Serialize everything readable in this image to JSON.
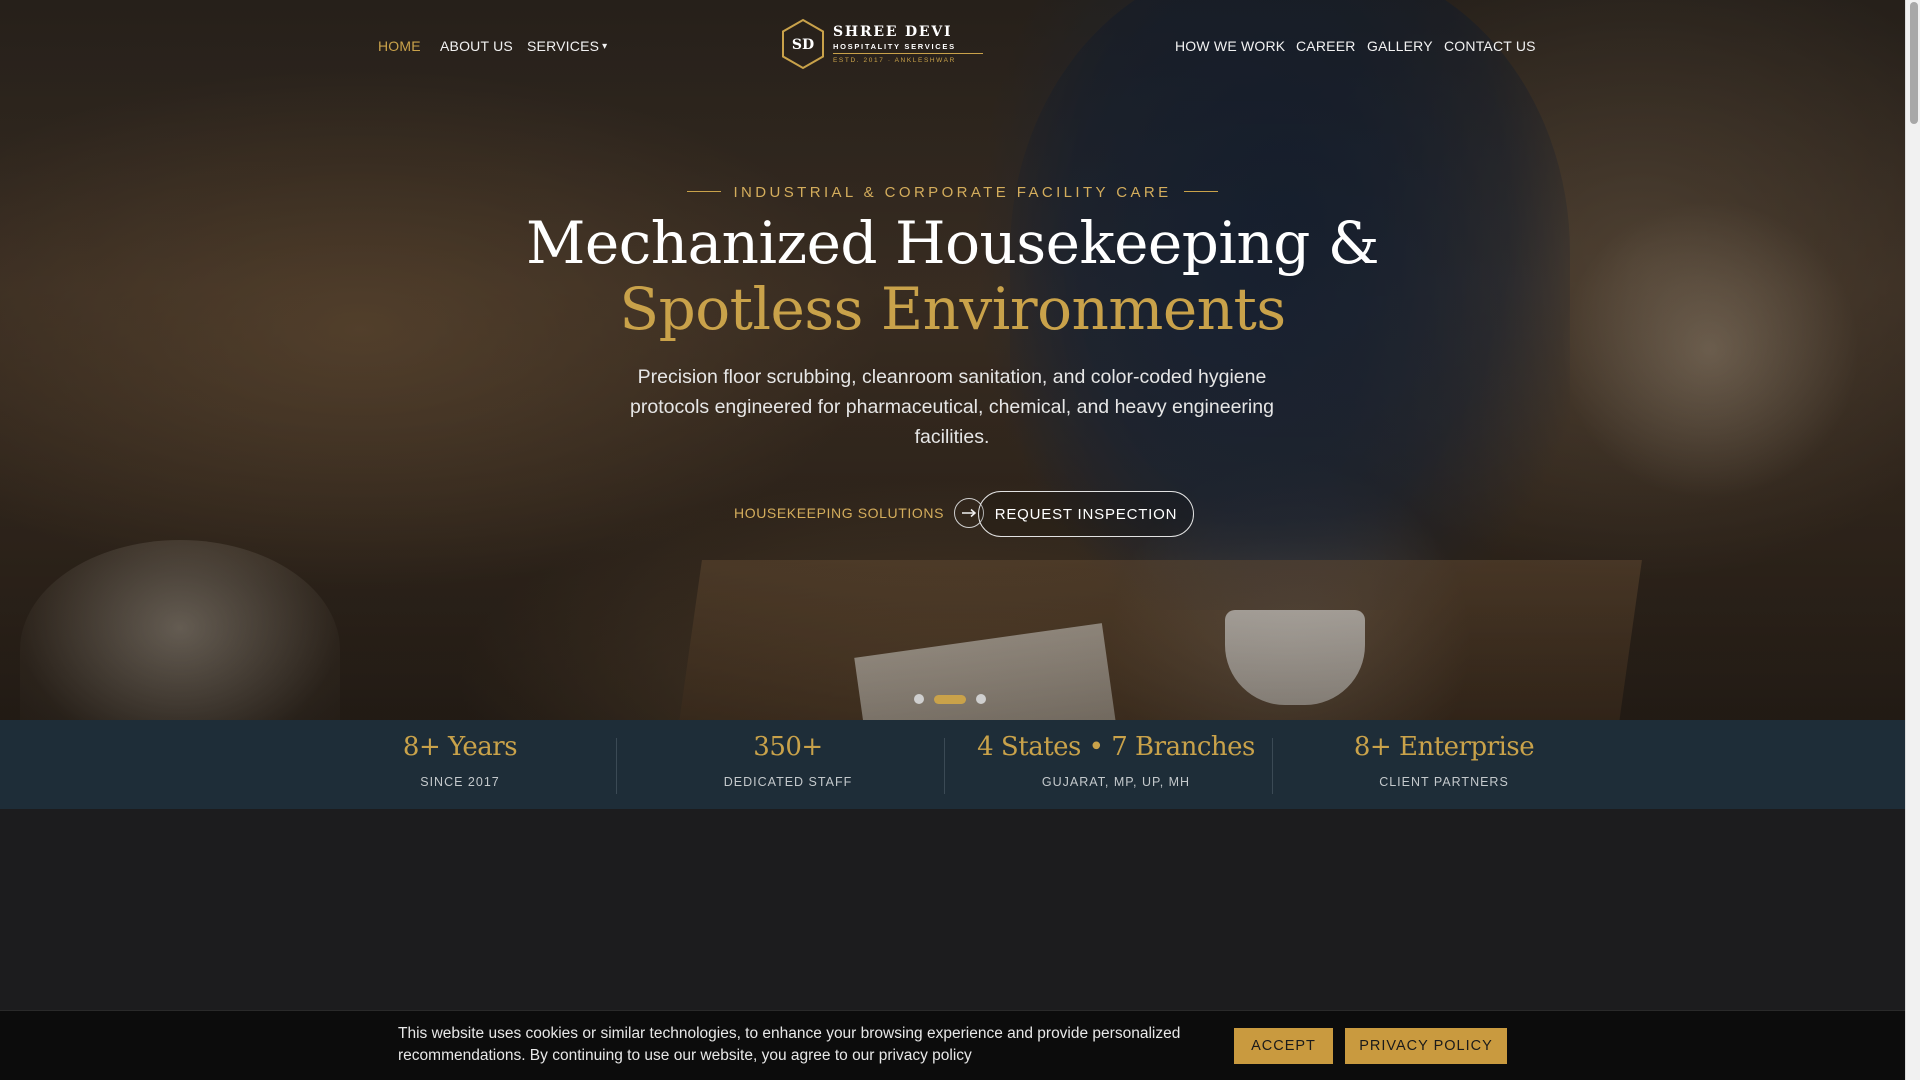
{
  "nav": {
    "left": [
      {
        "label": "HOME",
        "active": true
      },
      {
        "label": "ABOUT US"
      },
      {
        "label": "SERVICES",
        "caret": "▾"
      }
    ],
    "right": [
      {
        "label": "HOW WE WORK"
      },
      {
        "label": "CAREER"
      },
      {
        "label": "GALLERY"
      },
      {
        "label": "CONTACT US"
      }
    ]
  },
  "logo": {
    "initials": "SD",
    "name": "SHREE DEVI",
    "subtitle": "HOSPITALITY SERVICES",
    "estd": "ESTD. 2017 · ANKLESHWAR"
  },
  "hero": {
    "eyebrow": "INDUSTRIAL & CORPORATE FACILITY CARE",
    "headline_line1": "Mechanized Housekeeping &",
    "headline_line2": "Spotless Environments",
    "description": "Precision floor scrubbing, cleanroom sanitation, and color-coded hygiene protocols engineered for pharmaceutical, chemical, and heavy engineering facilities.",
    "cta_secondary": "HOUSEKEEPING SOLUTIONS",
    "cta_secondary_icon": "arrow-right-icon",
    "cta_primary": "REQUEST INSPECTION",
    "slides_total": 3,
    "active_slide": 2
  },
  "stats": [
    {
      "value": "8+ Years",
      "label": "SINCE 2017"
    },
    {
      "value": "350+",
      "label": "DEDICATED STAFF"
    },
    {
      "value": "4 States • 7 Branches",
      "label": "GUJARAT, MP, UP, MH"
    },
    {
      "value": "8+ Enterprise",
      "label": "CLIENT PARTNERS"
    }
  ],
  "cookie": {
    "text": "This website uses cookies or similar technologies, to enhance your browsing experience and provide personalized recommendations. By continuing to use our website, you agree to our privacy policy",
    "accept": "ACCEPT",
    "privacy": "PRIVACY POLICY"
  },
  "colors": {
    "gold": "#c9a24a",
    "stats_bg": "#1e2d38",
    "cookie_bg": "#0c0c0c",
    "page_bg": "#1c1c1e"
  }
}
